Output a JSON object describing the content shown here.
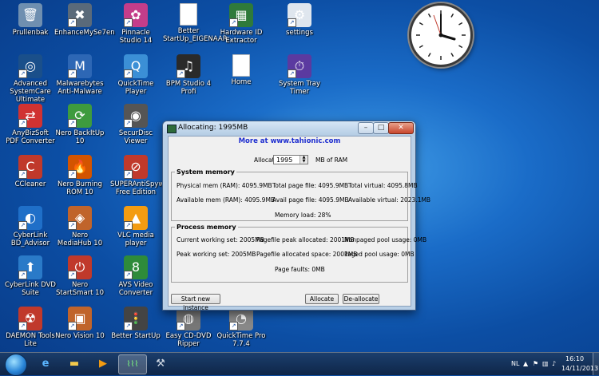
{
  "desktop": {
    "icons": [
      {
        "name": "icon-prullenbak",
        "label": "Prullenbak",
        "glyph": "🗑",
        "color": "#6f8fb0"
      },
      {
        "name": "icon-enhancemyse7en",
        "label": "EnhanceMySe7en",
        "glyph": "✖",
        "color": "#5a6a7a"
      },
      {
        "name": "icon-pinnacle-studio",
        "label": "Pinnacle Studio 14",
        "glyph": "✿",
        "color": "#c43d8a"
      },
      {
        "name": "icon-better-startup",
        "label": "Better StartUp_EIGENAAR...",
        "glyph": "",
        "color": "#ffffff"
      },
      {
        "name": "icon-hardware-id",
        "label": "Hardware ID Extractor",
        "glyph": "▦",
        "color": "#2f7a3a"
      },
      {
        "name": "icon-settings",
        "label": "settings",
        "glyph": "⚙",
        "color": "#dfe6ee"
      },
      {
        "name": "icon-advanced-systemcare",
        "label": "Advanced SystemCare Ultimate",
        "glyph": "◎",
        "color": "#1a4f8a"
      },
      {
        "name": "icon-malwarebytes",
        "label": "Malwarebytes Anti-Malware",
        "glyph": "M",
        "color": "#2d67b5"
      },
      {
        "name": "icon-quicktime",
        "label": "QuickTime Player",
        "glyph": "Q",
        "color": "#3b8fd6"
      },
      {
        "name": "icon-bpm-studio",
        "label": "BPM Studio 4 Profi",
        "glyph": "♫",
        "color": "#2a2a2a"
      },
      {
        "name": "icon-home",
        "label": "Home",
        "glyph": "",
        "color": "#ffffff"
      },
      {
        "name": "icon-system-tray-timer",
        "label": "System Tray Timer",
        "glyph": "⏱",
        "color": "#5b3aa0"
      },
      {
        "name": "icon-anybizsoft",
        "label": "AnyBizSoft PDF Converter",
        "glyph": "⇄",
        "color": "#d03232"
      },
      {
        "name": "icon-nero-backitup",
        "label": "Nero BackItUp 10",
        "glyph": "⟳",
        "color": "#3e9b3e"
      },
      {
        "name": "icon-securdisc",
        "label": "SecurDisc Viewer",
        "glyph": "◉",
        "color": "#555555"
      },
      {
        "name": "icon-ccleaner",
        "label": "CCleaner",
        "glyph": "C",
        "color": "#c0392b"
      },
      {
        "name": "icon-nero-burning",
        "label": "Nero Burning ROM 10",
        "glyph": "🔥",
        "color": "#d35400"
      },
      {
        "name": "icon-superantispyware",
        "label": "SUPERAntiSpyware Free Edition",
        "glyph": "⊘",
        "color": "#c0392b"
      },
      {
        "name": "icon-cyberlink-bd",
        "label": "CyberLink BD_Advisor",
        "glyph": "◐",
        "color": "#1f6fc8"
      },
      {
        "name": "icon-nero-mediahub",
        "label": "Nero MediaHub 10",
        "glyph": "◈",
        "color": "#c0642b"
      },
      {
        "name": "icon-vlc",
        "label": "VLC media player",
        "glyph": "▲",
        "color": "#f39c12"
      },
      {
        "name": "icon-cyberlink-dvd",
        "label": "CyberLink DVD Suite",
        "glyph": "⬆",
        "color": "#2a7ac8"
      },
      {
        "name": "icon-nero-startsmart",
        "label": "Nero StartSmart 10",
        "glyph": "⏻",
        "color": "#c0392b"
      },
      {
        "name": "icon-avs-video",
        "label": "AVS Video Converter",
        "glyph": "8",
        "color": "#2e8b3a"
      },
      {
        "name": "icon-daemon-tools",
        "label": "DAEMON Tools Lite",
        "glyph": "☢",
        "color": "#c0392b"
      },
      {
        "name": "icon-nero-vision",
        "label": "Nero Vision 10",
        "glyph": "▣",
        "color": "#c0642b"
      },
      {
        "name": "icon-better-startup-2",
        "label": "Better StartUp",
        "glyph": "🚦",
        "color": "#444444"
      },
      {
        "name": "icon-easy-cd-dvd",
        "label": "Easy CD-DVD Ripper",
        "glyph": "◍",
        "color": "#777777"
      },
      {
        "name": "icon-quicktime-pro",
        "label": "QuickTime Pro 7.7.4",
        "glyph": "◔",
        "color": "#888888"
      }
    ]
  },
  "window": {
    "title": "Allocating: 1995MB",
    "link": "More at www.tahionic.com",
    "allocate_label": "Allocate",
    "allocate_value": "1995",
    "allocate_unit": "MB of RAM",
    "system_memory": {
      "title": "System memory",
      "physical": "Physical mem (RAM): 4095.9MB",
      "total_page": "Total page file: 4095.9MB",
      "total_virtual": "Total virtual: 4095.8MB",
      "available": "Available mem (RAM): 4095.9MB",
      "avail_page": "Avail page file: 4095.9MB",
      "available_virtual": "Available virtual: 2023.1MB",
      "memory_load": "Memory load: 28%"
    },
    "process_memory": {
      "title": "Process memory",
      "current_ws": "Current working set: 2005MB",
      "pagefile_peak": "Pagefile peak allocated: 2001MB",
      "nonpaged": "Nonpaged pool usage: 0MB",
      "peak_ws": "Peak working set: 2005MB",
      "pagefile_alloc": "Pagefile allocated space: 2001MB",
      "paged": "Paged pool usage: 0MB",
      "page_faults": "Page faults: 0MB"
    },
    "buttons": {
      "start_new": "Start new instance",
      "allocate": "Allocate",
      "deallocate": "De-allocate"
    }
  },
  "taskbar": {
    "language": "NL",
    "time": "16:10",
    "date": "14/11/2013"
  }
}
